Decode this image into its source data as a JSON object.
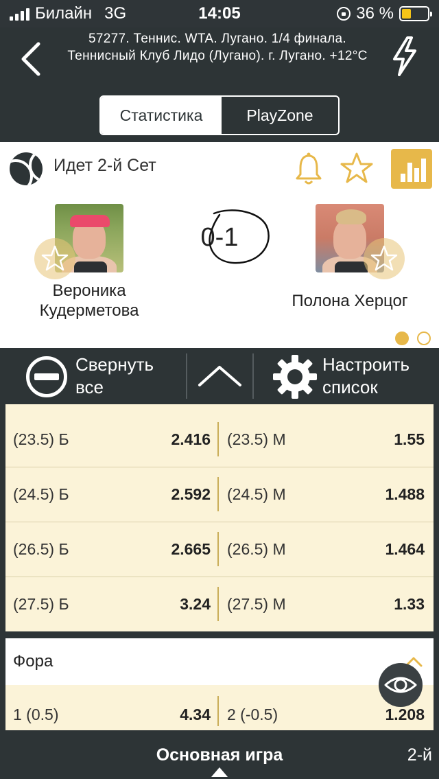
{
  "status_bar": {
    "carrier": "Билайн",
    "network": "3G",
    "time": "14:05",
    "battery": "36 %",
    "battery_level": 0.36
  },
  "header": {
    "title": "57277. Теннис. WTA. Лугано. 1/4 финала. Теннисный Клуб Лидо (Лугано). г. Лугано. +12°С"
  },
  "tabs": [
    {
      "label": "Статистика",
      "active": true
    },
    {
      "label": "PlayZone",
      "active": false
    }
  ],
  "match": {
    "status": "Идет 2-й  Сет",
    "score": "0-1",
    "player1": "Вероника Кудерметова",
    "player2": "Полона Херцог",
    "accent_color": "#e7b84a"
  },
  "toolbar": {
    "collapse_label_1": "Свернуть",
    "collapse_label_2": "все",
    "settings_label_1": "Настроить",
    "settings_label_2": "список"
  },
  "totals": [
    {
      "left_label": "(23.5) Б",
      "left_value": "2.416",
      "right_label": "(23.5) М",
      "right_value": "1.55"
    },
    {
      "left_label": "(24.5) Б",
      "left_value": "2.592",
      "right_label": "(24.5) М",
      "right_value": "1.488"
    },
    {
      "left_label": "(26.5) Б",
      "left_value": "2.665",
      "right_label": "(26.5) М",
      "right_value": "1.464"
    },
    {
      "left_label": "(27.5) Б",
      "left_value": "3.24",
      "right_label": "(27.5) М",
      "right_value": "1.33"
    }
  ],
  "fora": {
    "title": "Фора",
    "row": {
      "left_label": "1 (0.5)",
      "left_value": "4.34",
      "right_label": "2 (-0.5)",
      "right_value": "1.208"
    }
  },
  "bottom_bar": {
    "main": "Основная игра",
    "side": "2-й"
  }
}
